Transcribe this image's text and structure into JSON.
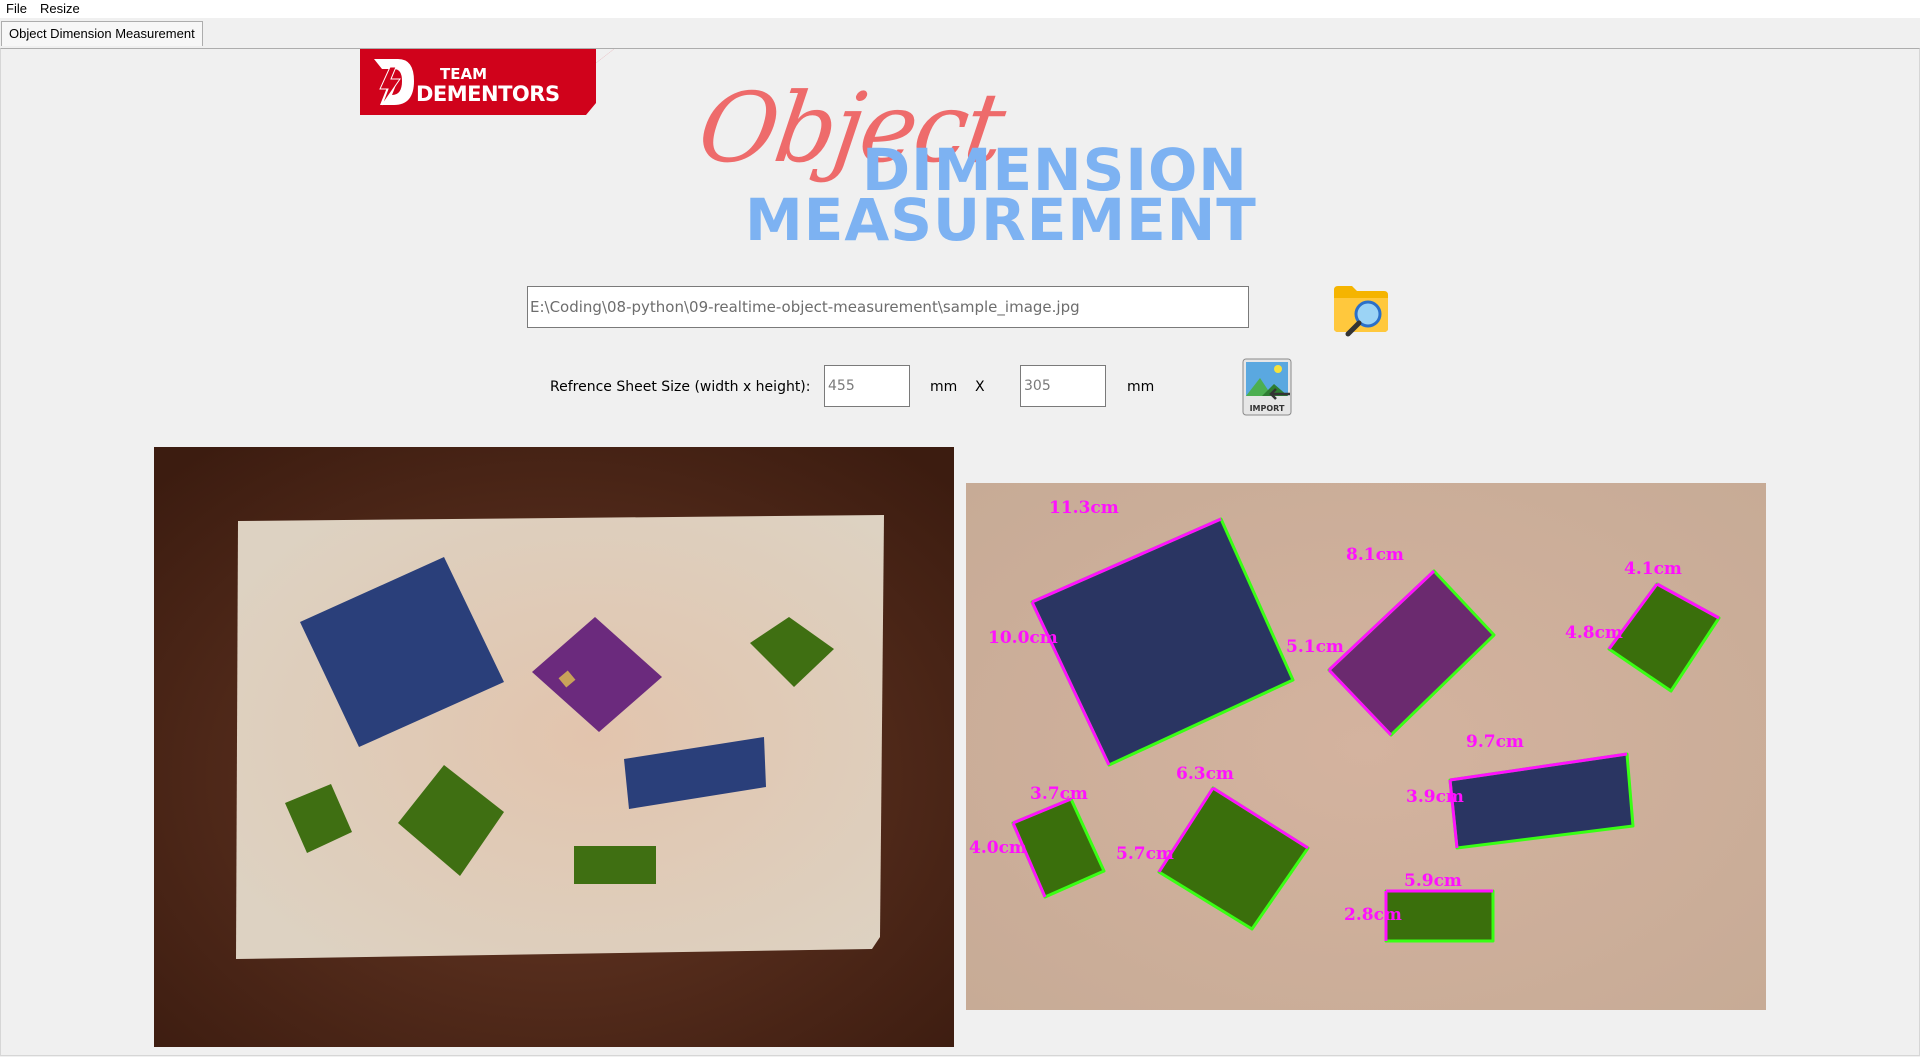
{
  "menu": {
    "file": "File",
    "resize": "Resize"
  },
  "tab": {
    "label": "Object Dimension Measurement"
  },
  "logo": {
    "line1": "TEAM",
    "line2": "DEMENTORS",
    "brand_color": "#d0021b"
  },
  "title": {
    "object": "Object",
    "dimension": "DIMENSION",
    "measurement": "MEASUREMENT",
    "colors": {
      "object": "#ee6b6b",
      "words": "#7db2f2"
    }
  },
  "file_path": {
    "value": "E:\\Coding\\08-python\\09-realtime-object-measurement\\sample_image.jpg"
  },
  "browse_button": {
    "icon": "folder-search-icon"
  },
  "reference": {
    "label": "Refrence Sheet Size (width x height):",
    "width": "455",
    "height": "305",
    "unit_width": "mm",
    "separator": "X",
    "unit_height": "mm"
  },
  "import_button": {
    "label": "IMPORT",
    "icon": "image-import-icon"
  },
  "output_image": {
    "measurements": [
      "11.3cm",
      "10.0cm",
      "8.1cm",
      "5.1cm",
      "4.1cm",
      "4.8cm",
      "9.7cm",
      "3.9cm",
      "6.3cm",
      "5.7cm",
      "3.7cm",
      "4.0cm",
      "5.9cm",
      "2.8cm"
    ],
    "box_color": "#39ff14",
    "arrow_color": "#ff10ff"
  }
}
